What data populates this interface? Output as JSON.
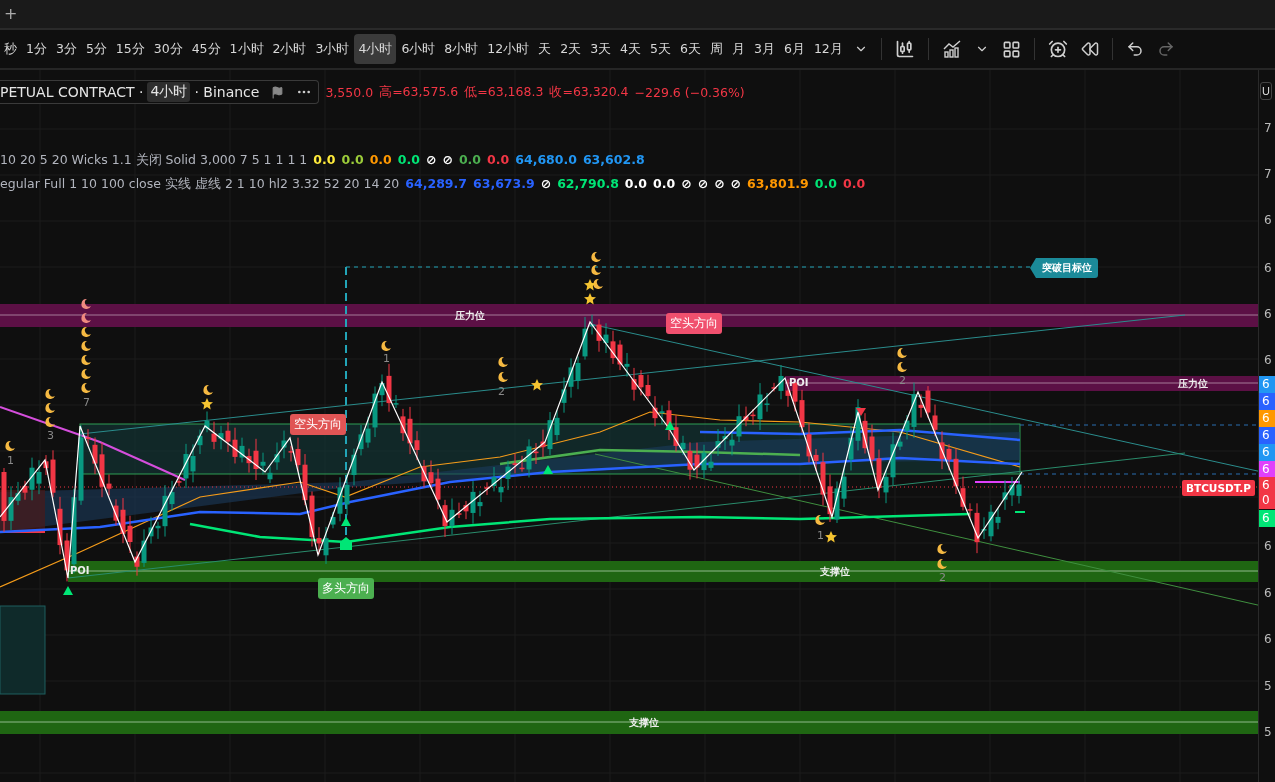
{
  "tab_bar": {
    "new_tab": "+"
  },
  "toolbar": {
    "intervals": [
      {
        "label": "秒",
        "selected": false
      },
      {
        "label": "1分",
        "selected": false
      },
      {
        "label": "3分",
        "selected": false
      },
      {
        "label": "5分",
        "selected": false
      },
      {
        "label": "15分",
        "selected": false
      },
      {
        "label": "30分",
        "selected": false
      },
      {
        "label": "45分",
        "selected": false
      },
      {
        "label": "1小时",
        "selected": false
      },
      {
        "label": "2小时",
        "selected": false
      },
      {
        "label": "3小时",
        "selected": false
      },
      {
        "label": "4小时",
        "selected": true
      },
      {
        "label": "6小时",
        "selected": false
      },
      {
        "label": "8小时",
        "selected": false
      },
      {
        "label": "12小时",
        "selected": false
      },
      {
        "label": "天",
        "selected": false
      },
      {
        "label": "2天",
        "selected": false
      },
      {
        "label": "3天",
        "selected": false
      },
      {
        "label": "4天",
        "selected": false
      },
      {
        "label": "5天",
        "selected": false
      },
      {
        "label": "6天",
        "selected": false
      },
      {
        "label": "周",
        "selected": false
      },
      {
        "label": "月",
        "selected": false
      },
      {
        "label": "3月",
        "selected": false
      },
      {
        "label": "6月",
        "selected": false
      },
      {
        "label": "12月",
        "selected": false
      }
    ]
  },
  "legend": {
    "symbol": "PETUAL CONTRACT ·",
    "interval": "4小时",
    "exchange": "· Binance",
    "ohlc": [
      "3,550.0",
      "高=63,575.6",
      "低=63,168.3",
      "收=63,320.4",
      "−229.6 (−0.36%)"
    ]
  },
  "indicators": [
    {
      "params": "10 20 5 20 Wicks 1.1 关闭 Solid 3,000 7 5 1 1 1 1",
      "values": [
        {
          "text": "0.0",
          "color": "#ffeb3b"
        },
        {
          "text": "0.0",
          "color": "#9ccc3a"
        },
        {
          "text": "0.0",
          "color": "#ff9800"
        },
        {
          "text": "0.0",
          "color": "#00e676"
        },
        {
          "text": "⊘",
          "color": "#ffffff"
        },
        {
          "text": "⊘",
          "color": "#ffffff"
        },
        {
          "text": "0.0",
          "color": "#4caf50"
        },
        {
          "text": "0.0",
          "color": "#f23645"
        },
        {
          "text": "64,680.0",
          "color": "#2196f3"
        },
        {
          "text": "63,602.8",
          "color": "#2196f3"
        }
      ]
    },
    {
      "params": "egular Full 1 10 100 close 实线 虚线 2 1 10 hl2 3.32 52 20 14 20",
      "values": [
        {
          "text": "64,289.7",
          "color": "#2962ff"
        },
        {
          "text": "63,673.9",
          "color": "#2962ff"
        },
        {
          "text": "⊘",
          "color": "#ffffff"
        },
        {
          "text": "62,790.8",
          "color": "#00e676"
        },
        {
          "text": "0.0",
          "color": "#ffffff"
        },
        {
          "text": "0.0",
          "color": "#ffffff"
        },
        {
          "text": "⊘",
          "color": "#ffffff"
        },
        {
          "text": "⊘",
          "color": "#ffffff"
        },
        {
          "text": "⊘",
          "color": "#ffffff"
        },
        {
          "text": "⊘",
          "color": "#ffffff"
        },
        {
          "text": "63,801.9",
          "color": "#ff9800"
        },
        {
          "text": "0.0",
          "color": "#00e676"
        },
        {
          "text": "0.0",
          "color": "#f23645"
        }
      ]
    }
  ],
  "chart": {
    "resistance_zone_top": {
      "label": "压力位"
    },
    "resistance_zone_right": {
      "poi": "POI",
      "label": "压力位"
    },
    "support_zone_middle": {
      "poi": "POI",
      "label": "支撑位"
    },
    "support_zone_bottom": {
      "label": "支撑位"
    },
    "target_badge": "突破目标位",
    "bearish_badges": [
      "空头方向",
      "空头方向"
    ],
    "bullish_badge": "多头方向",
    "symbol_tag": "BTCUSDT.P",
    "wave_counts": [
      "1",
      "3",
      "7",
      "1",
      "2",
      "2",
      "1",
      "2"
    ]
  },
  "price_axis": {
    "button": "U",
    "labels": [
      {
        "kind": "tick",
        "text": "7"
      },
      {
        "kind": "tick",
        "text": "7"
      },
      {
        "kind": "tick",
        "text": "6"
      },
      {
        "kind": "tick",
        "text": "6"
      },
      {
        "kind": "tick",
        "text": "6"
      },
      {
        "kind": "tick",
        "text": "6"
      },
      {
        "kind": "tag",
        "text": "6",
        "color": "#2196f3"
      },
      {
        "kind": "tag",
        "text": "6",
        "color": "#2962ff"
      },
      {
        "kind": "tag",
        "text": "6",
        "color": "#ff9800"
      },
      {
        "kind": "tag",
        "text": "6",
        "color": "#2962ff"
      },
      {
        "kind": "tag",
        "text": "6",
        "color": "#2196f3"
      },
      {
        "kind": "tag",
        "text": "6",
        "color": "#e040fb"
      },
      {
        "kind": "tag",
        "text": "6",
        "color": "#f23645",
        "countdown": "0"
      },
      {
        "kind": "tag",
        "text": "6",
        "color": "#00e676"
      },
      {
        "kind": "tick",
        "text": "6"
      },
      {
        "kind": "tick",
        "text": "6"
      },
      {
        "kind": "tick",
        "text": "6"
      },
      {
        "kind": "tick",
        "text": "5"
      },
      {
        "kind": "tick",
        "text": "5"
      }
    ]
  }
}
